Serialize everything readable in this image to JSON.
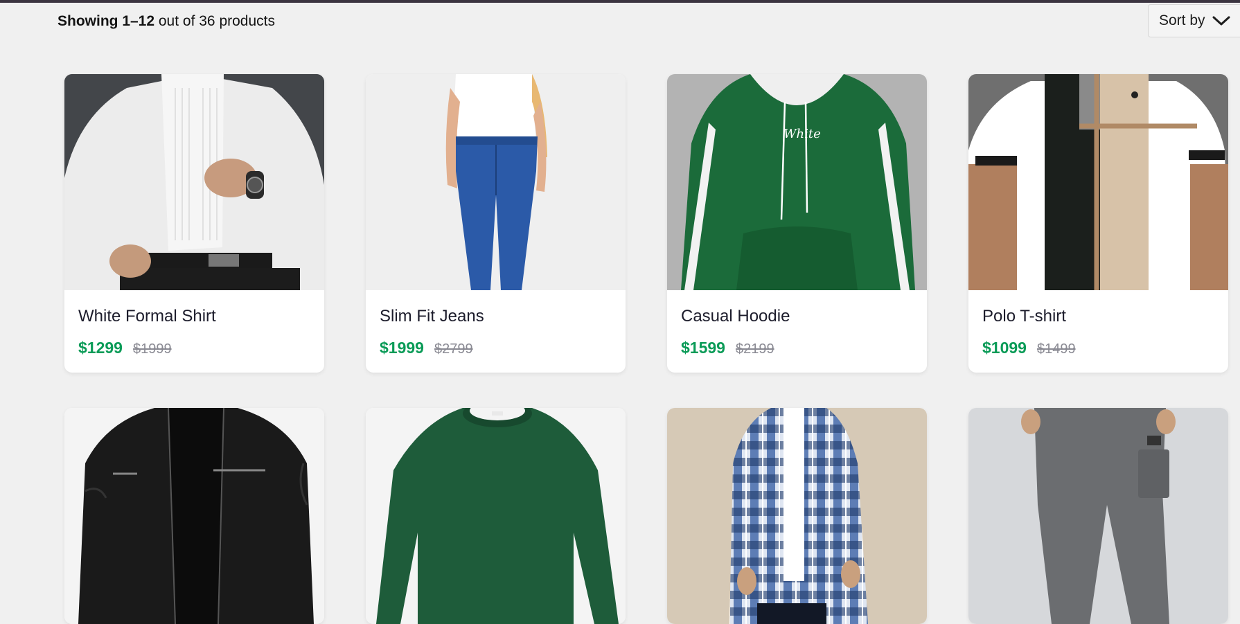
{
  "results": {
    "prefix": "Showing 1–12",
    "suffix": " out of 36 products"
  },
  "sort": {
    "label": "Sort by",
    "icon": "chevron-down-icon"
  },
  "colors": {
    "price": "#0a9b57",
    "old_price": "#8a8a93",
    "background": "#f0f0f0"
  },
  "products": [
    {
      "name": "White Formal Shirt",
      "price": "$1299",
      "old_price": "$1999",
      "image": "white-formal-shirt-photo"
    },
    {
      "name": "Slim Fit Jeans",
      "price": "$1999",
      "old_price": "$2799",
      "image": "slim-fit-jeans-photo"
    },
    {
      "name": "Casual Hoodie",
      "price": "$1599",
      "old_price": "$2199",
      "image": "casual-hoodie-photo"
    },
    {
      "name": "Polo T-shirt",
      "price": "$1099",
      "old_price": "$1499",
      "image": "polo-tshirt-photo"
    },
    {
      "image": "leather-jacket-photo"
    },
    {
      "image": "green-sweatshirt-photo"
    },
    {
      "image": "plaid-shirt-photo"
    },
    {
      "image": "grey-joggers-photo"
    }
  ]
}
